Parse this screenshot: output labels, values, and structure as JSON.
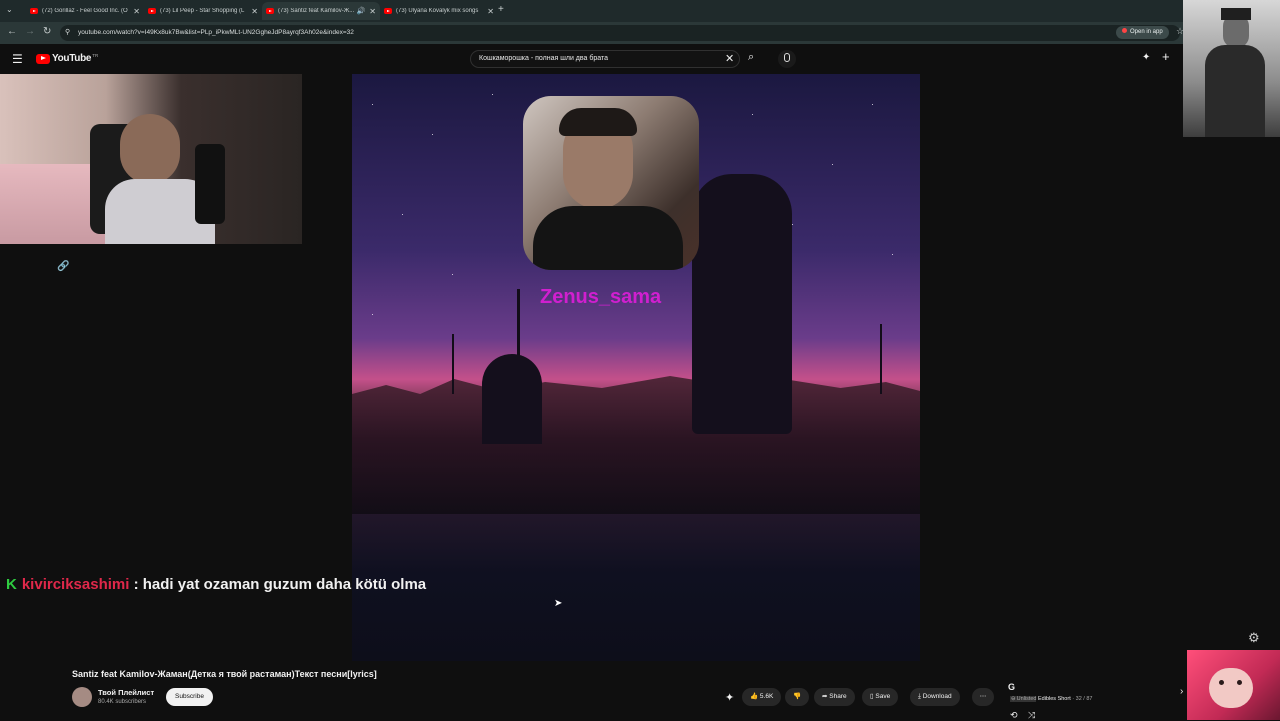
{
  "tabs": [
    {
      "title": "(72) Gorillaz - Feel Good Inc. (O"
    },
    {
      "title": "(73) Lil Peep - Star Shopping (L"
    },
    {
      "title": "(73) Santiz feat Kamilov-Ж..."
    },
    {
      "title": "(73) Ulyana Kovalyk mix songs"
    }
  ],
  "address": {
    "url": "youtube.com/watch?v=I49Kx8uk7Bw&list=PLp_iPkwMLt-UN2GgheJdP8ayrqf3Ah02e&index=32",
    "open_in_app": "Open in app"
  },
  "header": {
    "logo_text": "YouTube",
    "region": "TR",
    "search_value": "Кошкаморошка - полная шли два брата"
  },
  "video": {
    "watermark": "Zenus_sama"
  },
  "chat": {
    "username": "kivirciksashimi",
    "separator": ":",
    "message": "hadi yat ozaman guzum daha kötü olma"
  },
  "info": {
    "title": "Santiz feat Kamilov-Жаман(Детка я твой растаман)Текст песни[lyrics]",
    "channel_name": "Твой Плейлист",
    "subscribers": "80.4K subscribers",
    "subscribe_label": "Subscribe",
    "like_count": "5.6K",
    "share_label": "Share",
    "save_label": "Save",
    "download_label": "Download"
  },
  "playlist": {
    "initial": "G",
    "status": "Unlisted",
    "name": "Edibles Short",
    "position": "32 / 87"
  },
  "colors": {
    "chat_username": "#e0284a",
    "watermark": "#d01fcf",
    "youtube_red": "#ff0000"
  }
}
